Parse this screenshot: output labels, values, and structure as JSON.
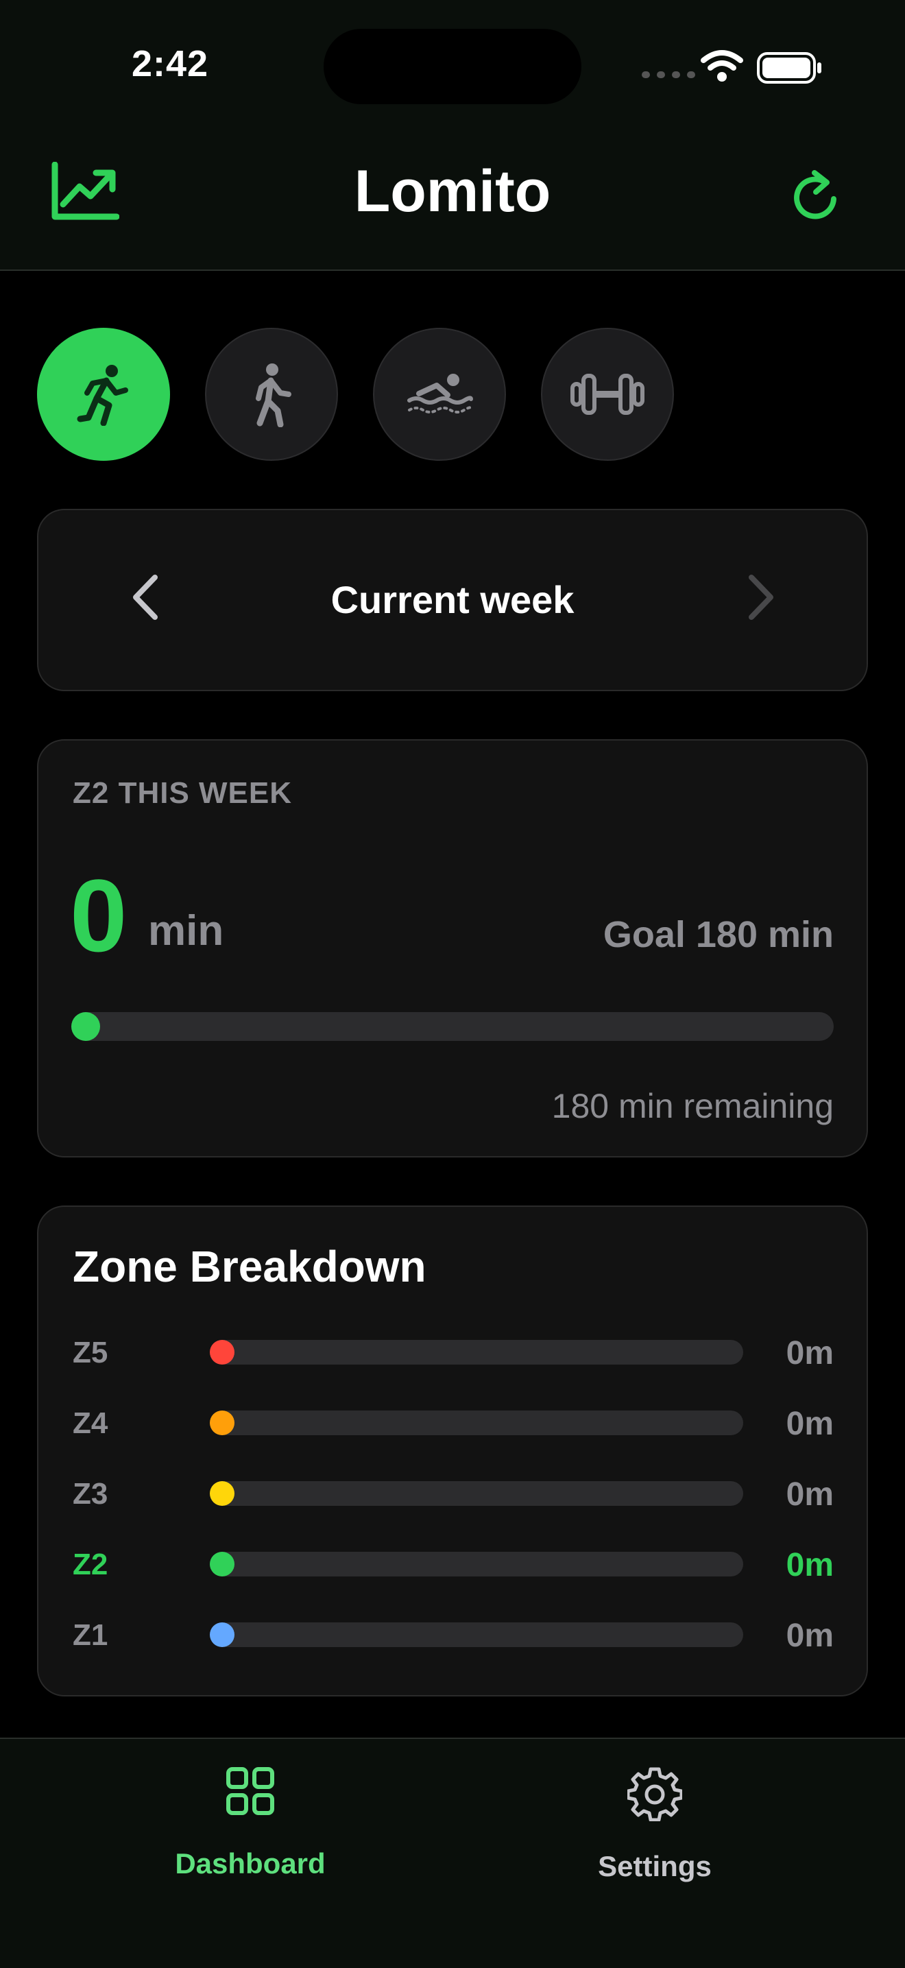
{
  "status_bar": {
    "time": "2:42"
  },
  "header": {
    "title": "Lomito",
    "chart_icon": "chart-up-icon",
    "refresh_icon": "refresh-icon"
  },
  "activities": [
    {
      "name": "running-icon",
      "selected": true
    },
    {
      "name": "walking-icon",
      "selected": false
    },
    {
      "name": "swimming-icon",
      "selected": false
    },
    {
      "name": "strength-icon",
      "selected": false
    }
  ],
  "week_nav": {
    "label": "Current week"
  },
  "z2": {
    "heading": "Z2 THIS WEEK",
    "value": "0",
    "unit": "min",
    "goal": "Goal 180 min",
    "remaining": "180 min remaining",
    "progress_fraction": 0
  },
  "zones": {
    "title": "Zone Breakdown",
    "items": [
      {
        "label": "Z5",
        "value": "0m",
        "color": "#ff453a",
        "fraction": 0
      },
      {
        "label": "Z4",
        "value": "0m",
        "color": "#ff9f0a",
        "fraction": 0
      },
      {
        "label": "Z3",
        "value": "0m",
        "color": "#ffd60a",
        "fraction": 0
      },
      {
        "label": "Z2",
        "value": "0m",
        "color": "#30d158",
        "fraction": 0,
        "highlight": true
      },
      {
        "label": "Z1",
        "value": "0m",
        "color": "#64a8ff",
        "fraction": 0
      }
    ]
  },
  "tabs": [
    {
      "label": "Dashboard",
      "icon": "grid-icon",
      "active": true
    },
    {
      "label": "Settings",
      "icon": "gear-icon",
      "active": false
    }
  ],
  "colors": {
    "accent": "#30d158",
    "background": "#000000",
    "card": "#121212"
  }
}
